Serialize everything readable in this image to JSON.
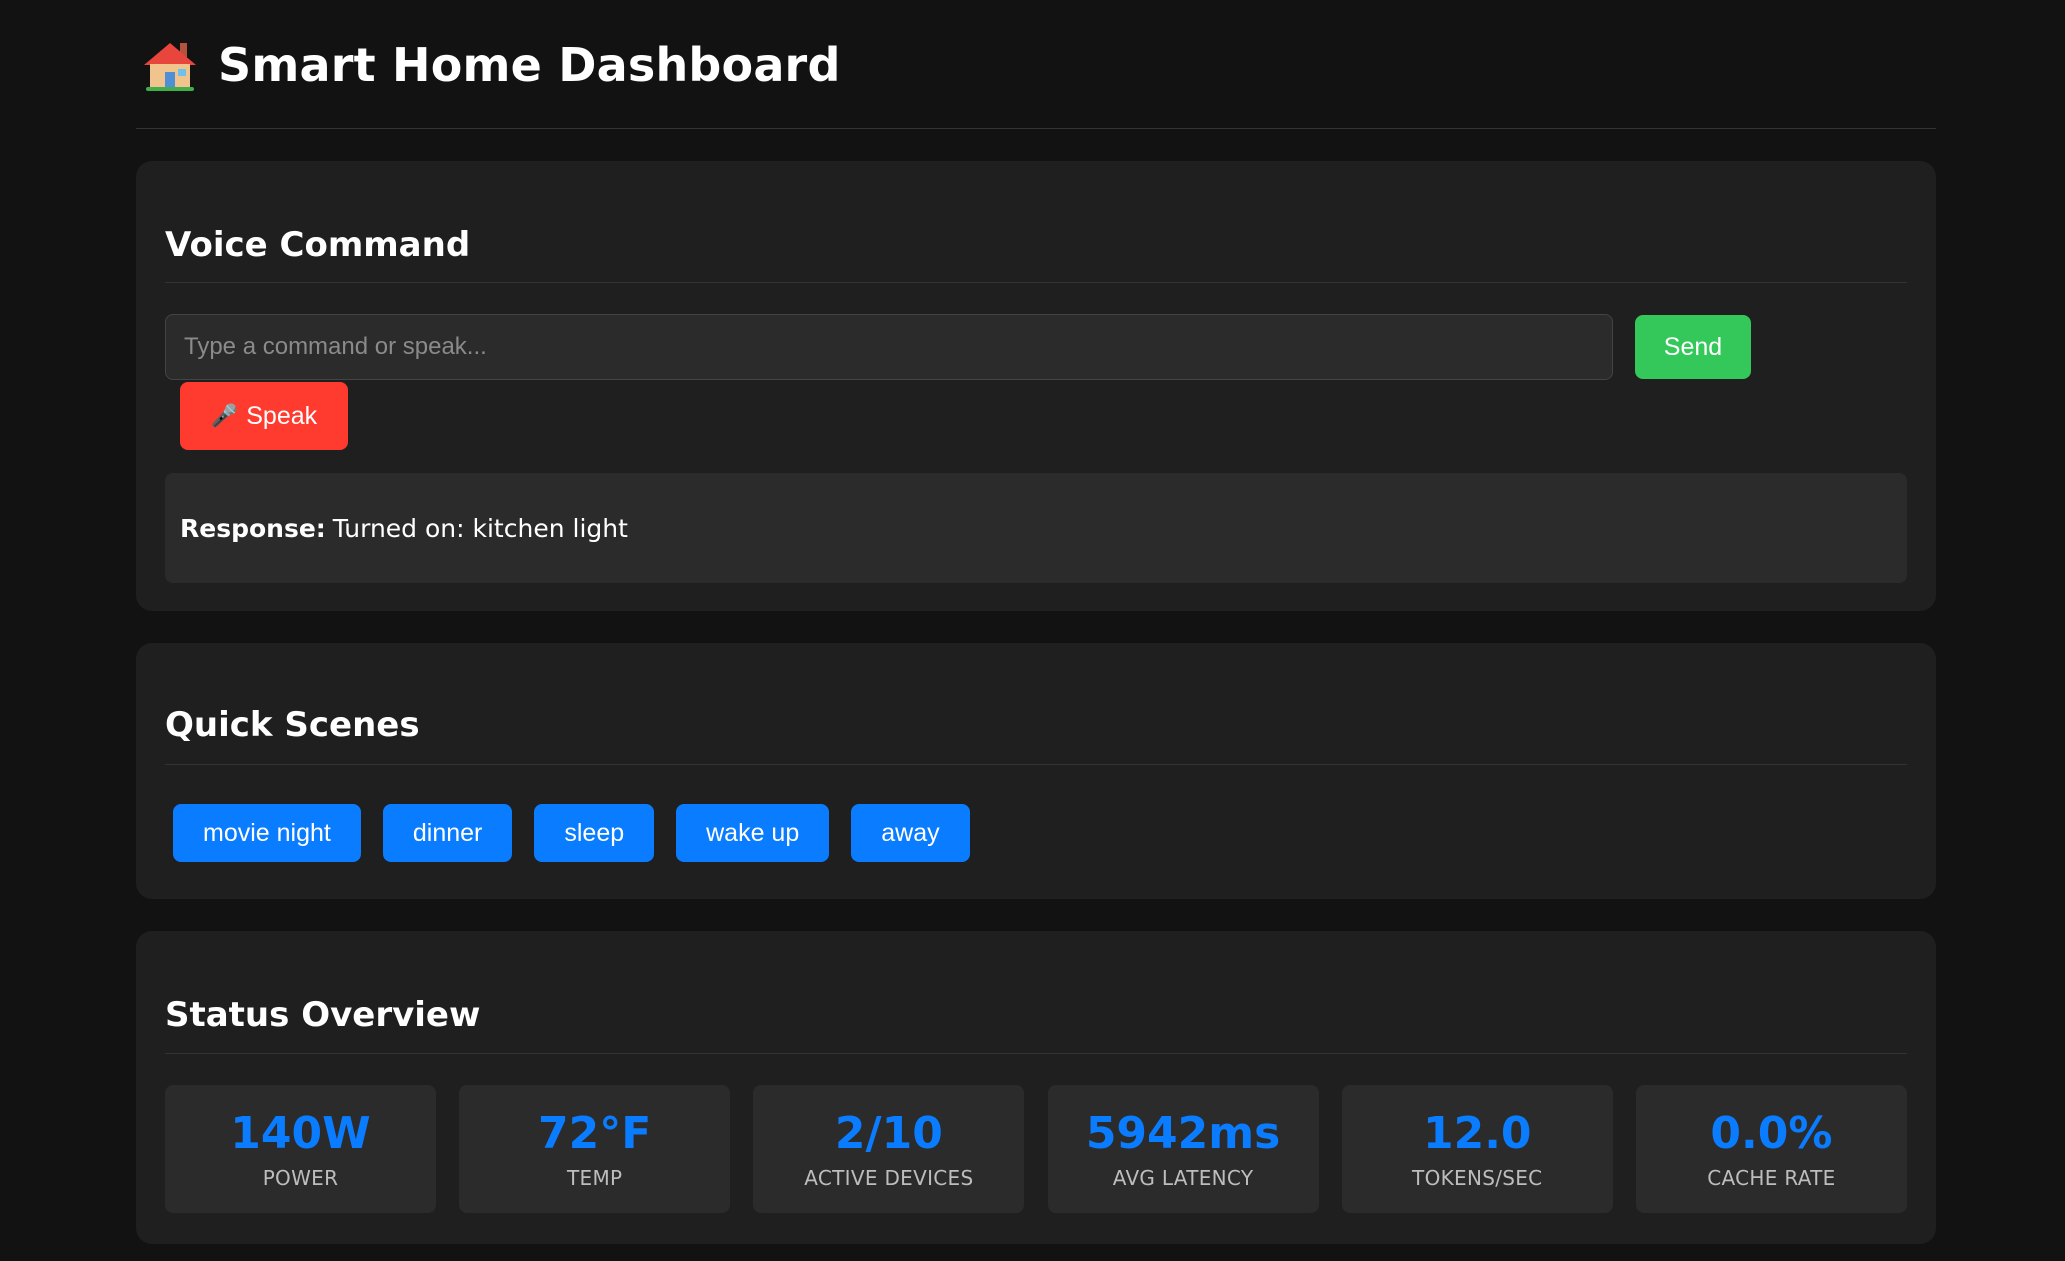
{
  "header": {
    "title": "Smart Home Dashboard",
    "icon": "house-icon"
  },
  "voice": {
    "title": "Voice Command",
    "input_placeholder": "Type a command or speak...",
    "input_value": "",
    "send_label": "Send",
    "speak_label": "Speak",
    "speak_icon": "microphone-icon",
    "response_label": "Response:",
    "response_text": "Turned on: kitchen light"
  },
  "scenes": {
    "title": "Quick Scenes",
    "items": [
      {
        "label": "movie night"
      },
      {
        "label": "dinner"
      },
      {
        "label": "sleep"
      },
      {
        "label": "wake up"
      },
      {
        "label": "away"
      }
    ]
  },
  "status": {
    "title": "Status Overview",
    "stats": [
      {
        "value": "140W",
        "label": "POWER"
      },
      {
        "value": "72°F",
        "label": "TEMP"
      },
      {
        "value": "2/10",
        "label": "ACTIVE DEVICES"
      },
      {
        "value": "5942ms",
        "label": "AVG LATENCY"
      },
      {
        "value": "12.0",
        "label": "TOKENS/SEC"
      },
      {
        "value": "0.0%",
        "label": "CACHE RATE"
      }
    ]
  },
  "colors": {
    "background": "#121212",
    "card": "#1f1f1f",
    "accent_blue": "#0a7cff",
    "send_green": "#34c759",
    "speak_red": "#ff3b30"
  }
}
